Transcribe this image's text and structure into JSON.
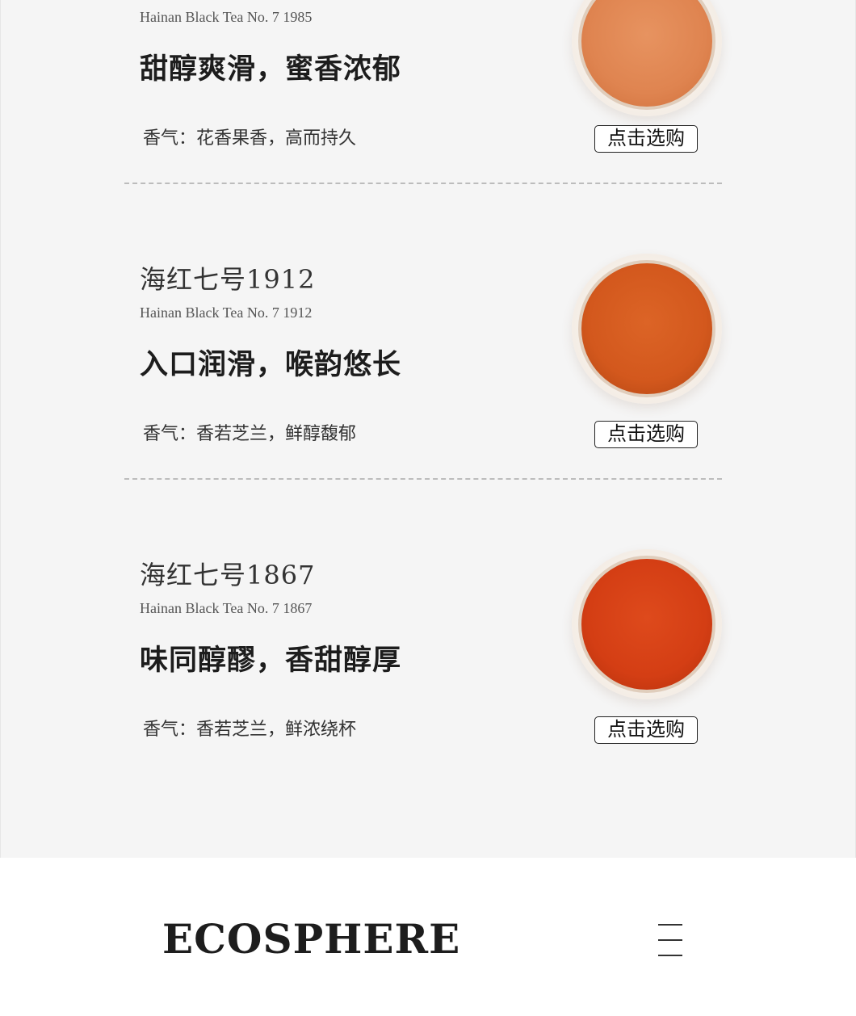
{
  "colors": {
    "panel_bg": "#f5f5f5",
    "text_dark": "#222222",
    "divider": "#bcbcbc"
  },
  "products": [
    {
      "name": "",
      "name_en": "Hainan Black Tea No. 7 1985",
      "slogan": "甜醇爽滑，蜜香浓郁",
      "aroma": "香气：花香果香，高而持久",
      "buy_label": "点击选购",
      "liquid_color": "#e0864f",
      "liquid_color_edge": "#cf6f3a"
    },
    {
      "name": "海红七号1912",
      "name_en": "Hainan Black Tea No. 7 1912",
      "slogan": "入口润滑，喉韵悠长",
      "aroma": "香气：香若芝兰，鲜醇馥郁",
      "buy_label": "点击选购",
      "liquid_color": "#d3581d",
      "liquid_color_edge": "#b04412"
    },
    {
      "name": "海红七号1867",
      "name_en": "Hainan Black Tea No. 7 1867",
      "slogan": "味同醇醪，香甜醇厚",
      "aroma": "香气：香若芝兰，鲜浓绕杯",
      "buy_label": "点击选购",
      "liquid_color": "#d43e14",
      "liquid_color_edge": "#b2300c"
    }
  ],
  "footer": {
    "brand": "ECOSPHERE",
    "menu_icon": "hamburger-menu-icon"
  }
}
